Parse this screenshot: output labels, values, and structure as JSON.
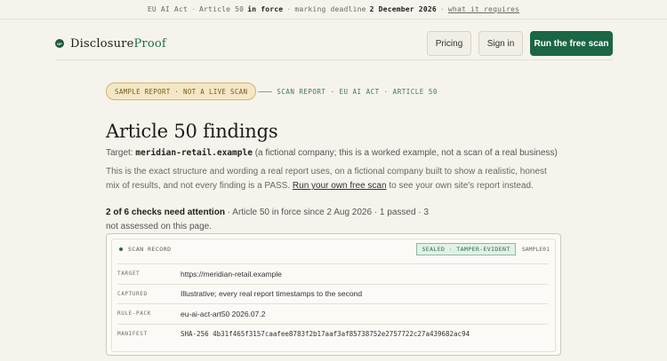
{
  "topbar": {
    "act": "EU AI Act",
    "sep": "·",
    "article": "Article 50",
    "in_force": "in force",
    "deadline_label": "marking deadline",
    "deadline": "2 December 2026",
    "link": "what it requires"
  },
  "header": {
    "brand_plain": "Disclosure",
    "brand_bold": "Proof",
    "badge": "DP",
    "pricing": "Pricing",
    "signin": "Sign in",
    "cta": "Run the free scan"
  },
  "badge_row": {
    "sample": "SAMPLE REPORT · NOT A LIVE SCAN",
    "scan": "SCAN REPORT · EU AI ACT · ARTICLE 50"
  },
  "main": {
    "title": "Article 50 findings",
    "target_label": "Target:",
    "target_domain": "meridian-retail.example",
    "target_note": "(a fictional company; this is a worked example, not a scan of a real business)",
    "intro_text": "This is the exact structure and wording a real report uses, on a fictional company built to show a realistic, honest mix of results, and not every finding is a PASS.",
    "intro_link": "Run your own free scan",
    "intro_tail": "to see your own site's report instead.",
    "summary_bold": "2 of 6 checks need attention",
    "summary_rest": "· Article 50 in force since 2 Aug 2026 · 1 passed · 3 not assessed on this page."
  },
  "card": {
    "title": "SCAN RECORD",
    "sealed": "SEALED · TAMPER-EVIDENT",
    "id": "SAMPLE01",
    "rows": [
      {
        "key": "TARGET",
        "value": "https://meridian-retail.example"
      },
      {
        "key": "CAPTURED",
        "value": "Illustrative; every real report timestamps to the second"
      },
      {
        "key": "RULE-PACK",
        "value": "eu-ai-act-art50 2026.07.2"
      },
      {
        "key": "MANIFEST",
        "value": "SHA-256 4b31f465f3157caafee8783f2b17aaf3af85738752e2757722c27a439682ac94"
      }
    ]
  }
}
